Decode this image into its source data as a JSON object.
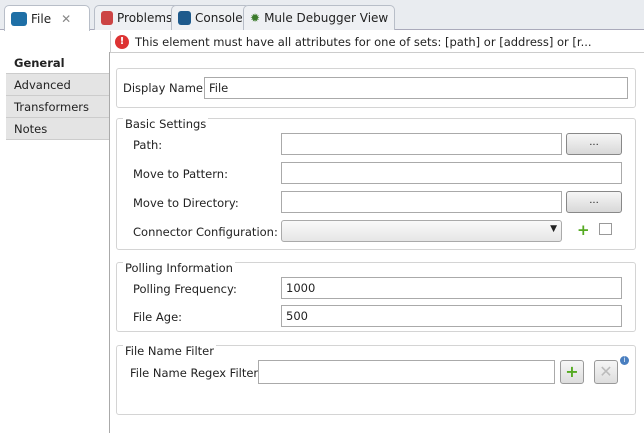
{
  "tabs": [
    {
      "label": "File",
      "active": true,
      "icon": "folder-icon"
    },
    {
      "label": "Problems",
      "icon": "problems-icon"
    },
    {
      "label": "Console",
      "icon": "console-icon"
    },
    {
      "label": "Mule Debugger View",
      "icon": "bug-icon"
    }
  ],
  "error": {
    "message": "This element must have all attributes for one of sets: [path] or [address] or [r..."
  },
  "sidebar": {
    "items": [
      {
        "label": "General"
      },
      {
        "label": "Advanced"
      },
      {
        "label": "Transformers"
      },
      {
        "label": "Notes"
      }
    ]
  },
  "display_name": {
    "label": "Display Name:",
    "value": "File"
  },
  "basic": {
    "title": "Basic Settings",
    "path": "Path:",
    "move_pattern": "Move to Pattern:",
    "move_dir": "Move to Directory:",
    "connector": "Connector Configuration:",
    "browse": "..."
  },
  "polling": {
    "title": "Polling Information",
    "freq_label": "Polling Frequency:",
    "freq": "1000",
    "age_label": "File Age:",
    "age": "500"
  },
  "filter": {
    "title": "File Name Filter",
    "regex_label": "File Name Regex Filter:"
  }
}
